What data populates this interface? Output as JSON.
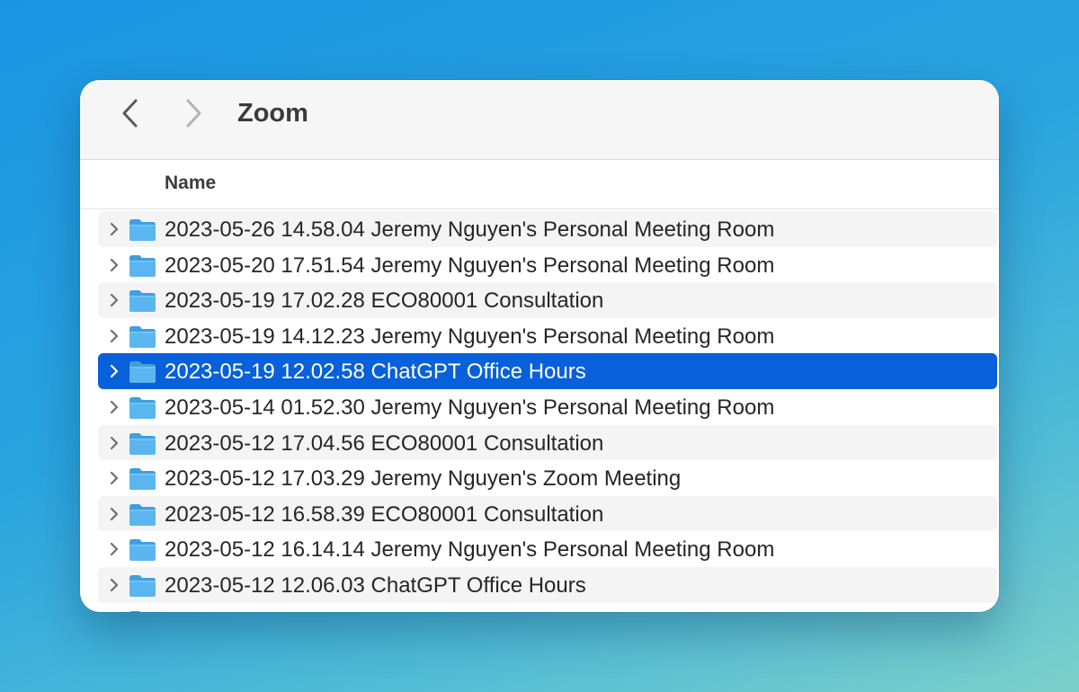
{
  "window": {
    "title": "Zoom"
  },
  "toolbar": {
    "back_icon": "chevron-left-icon",
    "forward_icon": "chevron-right-icon"
  },
  "columns": {
    "name": "Name"
  },
  "colors": {
    "selection": "#0860da",
    "folder": "#5bb6f0",
    "folder_tab": "#3f9fe0"
  },
  "folders": [
    {
      "name": "2023-05-26 14.58.04 Jeremy Nguyen's Personal Meeting Room",
      "selected": false
    },
    {
      "name": "2023-05-20 17.51.54 Jeremy Nguyen's Personal Meeting Room",
      "selected": false
    },
    {
      "name": "2023-05-19 17.02.28 ECO80001 Consultation",
      "selected": false
    },
    {
      "name": "2023-05-19 14.12.23 Jeremy Nguyen's Personal Meeting Room",
      "selected": false
    },
    {
      "name": "2023-05-19 12.02.58 ChatGPT Office Hours",
      "selected": true
    },
    {
      "name": "2023-05-14 01.52.30 Jeremy Nguyen's Personal Meeting Room",
      "selected": false
    },
    {
      "name": "2023-05-12 17.04.56 ECO80001 Consultation",
      "selected": false
    },
    {
      "name": "2023-05-12 17.03.29 Jeremy Nguyen's Zoom Meeting",
      "selected": false
    },
    {
      "name": "2023-05-12 16.58.39 ECO80001 Consultation",
      "selected": false
    },
    {
      "name": "2023-05-12 16.14.14 Jeremy Nguyen's Personal Meeting Room",
      "selected": false
    },
    {
      "name": "2023-05-12 12.06.03 ChatGPT Office Hours",
      "selected": false
    }
  ]
}
